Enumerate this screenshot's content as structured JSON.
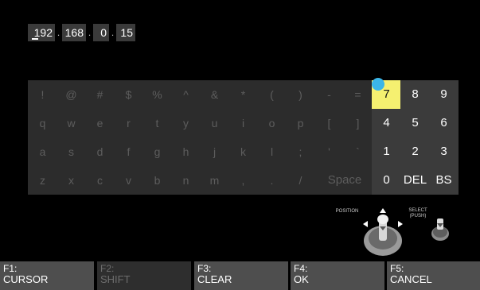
{
  "ip_address": {
    "segments": [
      "192",
      "168",
      "0",
      "15"
    ],
    "separator": "."
  },
  "keyboard": {
    "rows": [
      [
        "!",
        "@",
        "#",
        "$",
        "%",
        "^",
        "&",
        "*",
        "(",
        ")",
        "-",
        "="
      ],
      [
        "q",
        "w",
        "e",
        "r",
        "t",
        "y",
        "u",
        "i",
        "o",
        "p",
        "[",
        "]"
      ],
      [
        "a",
        "s",
        "d",
        "f",
        "g",
        "h",
        "j",
        "k",
        "l",
        ";",
        "'",
        "`"
      ],
      [
        "z",
        "x",
        "c",
        "v",
        "b",
        "n",
        "m",
        ",",
        ".",
        "/"
      ]
    ],
    "space_label": "Space",
    "numpad": [
      [
        "7",
        "8",
        "9"
      ],
      [
        "4",
        "5",
        "6"
      ],
      [
        "1",
        "2",
        "3"
      ],
      [
        "0",
        "DEL",
        "BS"
      ]
    ],
    "selected_key": "7"
  },
  "controls": {
    "position_label": "POSITION",
    "select_label_line1": "SELECT",
    "select_label_line2": "(PUSH)"
  },
  "function_keys": [
    {
      "name": "F1:",
      "action": "CURSOR",
      "enabled": true
    },
    {
      "name": "F2:",
      "action": "SHIFT",
      "enabled": false
    },
    {
      "name": "F3:",
      "action": "CLEAR",
      "enabled": true
    },
    {
      "name": "F4:",
      "action": "OK",
      "enabled": true
    },
    {
      "name": "F5:",
      "action": "CANCEL",
      "enabled": true
    }
  ],
  "colors": {
    "background": "#000000",
    "key_dim": "#2c2c2c",
    "key_numpad": "#3b3b3b",
    "key_selected": "#f5f070",
    "marker": "#3bb6e8",
    "fkey_bg": "#4e4e4e"
  }
}
